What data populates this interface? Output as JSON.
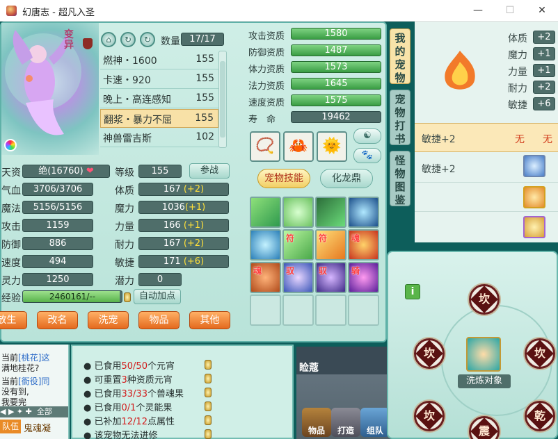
{
  "window": {
    "title": "幻唐志 - 超凡入圣",
    "minimize": "—",
    "maximize": "☐",
    "close": "✕"
  },
  "pet_title": "变异",
  "pet_list": {
    "qty_label": "数量",
    "qty_value": "17/17",
    "items": [
      {
        "name": "燃神・1600",
        "level": "155"
      },
      {
        "name": "卡速・920",
        "level": "155"
      },
      {
        "name": "晚上・高连感知",
        "level": "155"
      },
      {
        "name": "翻浆・暴力不屈",
        "level": "155",
        "selected": true
      },
      {
        "name": "神兽雷吉斯",
        "level": "102"
      }
    ]
  },
  "stats_left": [
    {
      "label": "天资",
      "value": "绝(16760)"
    },
    {
      "label": "气血",
      "value": "3706/3706"
    },
    {
      "label": "魔法",
      "value": "5156/5156"
    },
    {
      "label": "攻击",
      "value": "1159"
    },
    {
      "label": "防御",
      "value": "886"
    },
    {
      "label": "速度",
      "value": "494"
    },
    {
      "label": "灵力",
      "value": "1250"
    }
  ],
  "stats_right": [
    {
      "label": "等级",
      "value": "155",
      "bonus": ""
    },
    {
      "label": "体质",
      "value": "167",
      "bonus": "(+2)"
    },
    {
      "label": "魔力",
      "value": "1036",
      "bonus": "(+1)"
    },
    {
      "label": "力量",
      "value": "166",
      "bonus": "(+1)"
    },
    {
      "label": "耐力",
      "value": "167",
      "bonus": "(+2)"
    },
    {
      "label": "敏捷",
      "value": "171",
      "bonus": "(+6)"
    },
    {
      "label": "潜力",
      "value": "0",
      "bonus": ""
    }
  ],
  "exp": {
    "label": "经验",
    "value": "2460161/--",
    "fill": 0.98
  },
  "buttons": {
    "battle": "参战",
    "auto_add": "自动加点",
    "bottom": [
      "放生",
      "改名",
      "洗宠",
      "物品",
      "其他"
    ]
  },
  "aptitude": [
    {
      "label": "攻击资质",
      "value": "1580"
    },
    {
      "label": "防御资质",
      "value": "1487"
    },
    {
      "label": "体力资质",
      "value": "1573"
    },
    {
      "label": "法力资质",
      "value": "1645"
    },
    {
      "label": "速度资质",
      "value": "1575"
    }
  ],
  "life": {
    "label": "寿　命",
    "value": "19462"
  },
  "skill_tabs": {
    "skills": "宠物技能",
    "dragon": "化龙鼎"
  },
  "skill_marks": [
    "",
    "",
    "",
    "",
    "",
    "符",
    "符",
    "魂",
    "魂",
    "驭",
    "驭",
    "骑"
  ],
  "side_tabs": [
    "我的宠物",
    "宠物打书",
    "怪物图鉴"
  ],
  "right_attrs": [
    {
      "label": "体质",
      "value": "+2"
    },
    {
      "label": "魔力",
      "value": "+1"
    },
    {
      "label": "力量",
      "value": "+1"
    },
    {
      "label": "耐力",
      "value": "+2"
    },
    {
      "label": "敏捷",
      "value": "+6"
    }
  ],
  "right_rows": [
    {
      "text": "敏捷+2",
      "col2": "无",
      "col3": "无"
    },
    {
      "text": "敏捷+2"
    }
  ],
  "log": [
    "当前",
    "[桃花]这",
    "满地桂花?",
    "当前",
    "[衙役]同",
    "没有到,",
    "我要完",
    "全部",
    "队伍",
    "队伍",
    "鬼魂凝"
  ],
  "info_lines": [
    {
      "pre": "已食用",
      "red": "50/50",
      "post": "个元宵"
    },
    {
      "pre": "可重置",
      "red": "3",
      "post": "种资质元宵"
    },
    {
      "pre": "已食用",
      "red": "33/33",
      "post": "个兽魂果"
    },
    {
      "pre": "已食用",
      "red": "0/1",
      "post": "个灵能果"
    },
    {
      "pre": "已补加",
      "red": "12/12",
      "post": "点属性"
    },
    {
      "pre": "该宠物无法进修",
      "red": "",
      "post": ""
    }
  ],
  "scene_text": {
    "sign": "睑蔻",
    "bag1": "物品",
    "bag2": "打造",
    "bag3": "组队"
  },
  "refine": {
    "target_label": "洗炼对象",
    "info_icon": "i",
    "gua": [
      "坎",
      "坎",
      "坎",
      "坎",
      "乾",
      "震"
    ]
  }
}
